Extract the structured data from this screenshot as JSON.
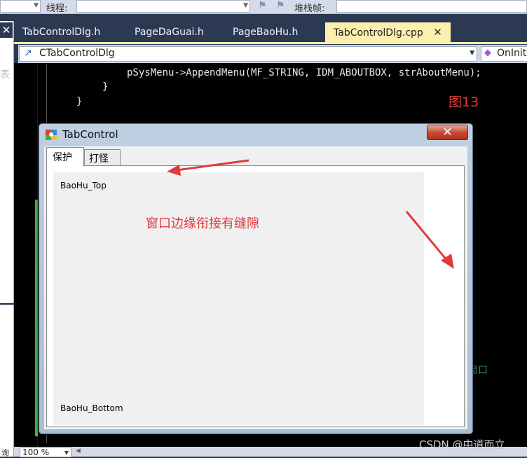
{
  "toolbar": {
    "thread_label": "线程:",
    "stack_frame_label": "堆栈帧:"
  },
  "document_tabs": [
    {
      "label": "TabControlDlg.h",
      "active": false
    },
    {
      "label": "PageDaGuai.h",
      "active": false
    },
    {
      "label": "PageBaoHu.h",
      "active": false
    },
    {
      "label": "TabControlDlg.cpp",
      "active": true
    }
  ],
  "tab_close_glyph": "✕",
  "left_panel": {
    "close_glyph": "✕",
    "ghost_text": "表"
  },
  "navbar": {
    "class_selector": "CTabControlDlg",
    "member_selector": "OnInitDialog"
  },
  "code_lines": [
    "pSysMenu->AppendMenu(MF_STRING, IDM_ABOUTBOX, strAboutMenu);",
    "}",
    "}"
  ],
  "figure_label": "图13",
  "ghost_comment": "窗口",
  "dialog": {
    "title": "TabControl",
    "close_glyph": "✕",
    "tabs": [
      {
        "label": "保护",
        "selected": true
      },
      {
        "label": "打怪",
        "selected": false
      }
    ],
    "page_top_label": "BaoHu_Top",
    "page_bottom_label": "BaoHu_Bottom"
  },
  "annotation": "窗口边缘衔接有缝隙",
  "statusbar": {
    "zoom": "100 %",
    "left_text": "询"
  },
  "watermark": "CSDN @中道而立",
  "colors": {
    "annotation_red": "#e23a3a",
    "active_tab": "#fdf0ad",
    "editor_bg": "#000000",
    "chrome": "#2b3a52"
  }
}
